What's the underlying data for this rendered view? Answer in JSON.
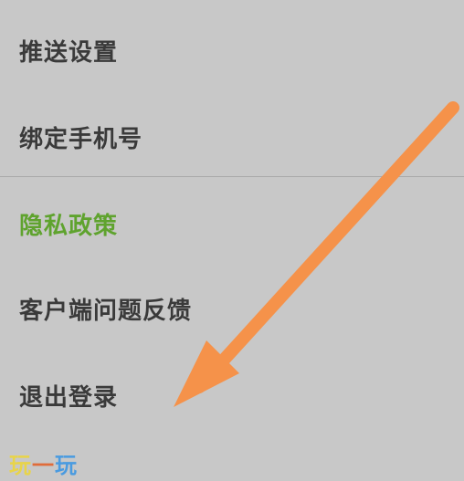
{
  "menu": {
    "items": [
      {
        "label": "推送设置"
      },
      {
        "label": "绑定手机号"
      },
      {
        "label": "隐私政策"
      },
      {
        "label": "客户端问题反馈"
      },
      {
        "label": "退出登录"
      }
    ]
  },
  "annotation": {
    "arrow_color": "#f5924a"
  },
  "watermark": {
    "char1": "玩",
    "char2": "一",
    "char3": "玩"
  },
  "colors": {
    "background": "#c8c8c8",
    "text": "#3a3a3a",
    "highlight": "#5fa32e",
    "divider": "#a9a9a9"
  }
}
